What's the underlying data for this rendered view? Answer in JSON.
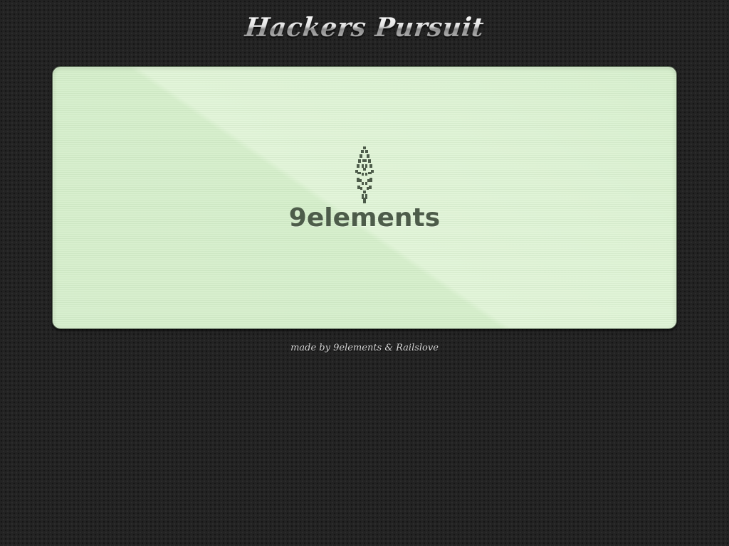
{
  "header": {
    "title": "Hackers Pursuit"
  },
  "screen": {
    "logo_icon": "rocket-icon",
    "logo_text": "9elements",
    "background_color": "#d9f0d0",
    "logo_color": "#4d5c4a"
  },
  "footer": {
    "prefix": "made by",
    "brand_1": "9elements",
    "separator": "&",
    "brand_2": "Railslove"
  }
}
